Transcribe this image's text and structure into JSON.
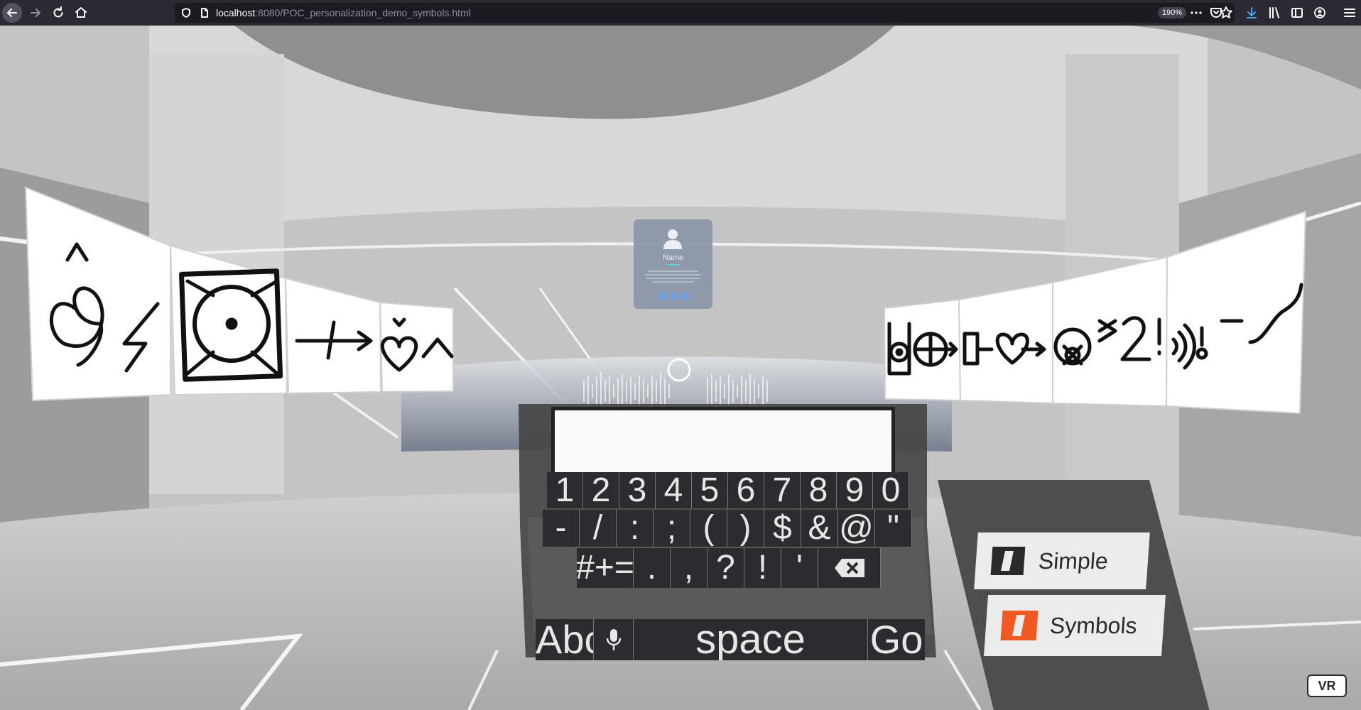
{
  "browser": {
    "url_host": "localhost",
    "url_rest": ":8080/POC_personalization_demo_symbols.html",
    "zoom": "190%"
  },
  "profile": {
    "name": "Name"
  },
  "keyboard": {
    "row1": [
      "1",
      "2",
      "3",
      "4",
      "5",
      "6",
      "7",
      "8",
      "9",
      "0"
    ],
    "row2": [
      "-",
      "/",
      ":",
      ";",
      "(",
      ")",
      "$",
      "&",
      "@",
      "\""
    ],
    "row3": [
      "#+=",
      ".",
      ",",
      "?",
      "!",
      "'"
    ],
    "row4": {
      "abc": "Abc",
      "space": "space",
      "go": "Go"
    }
  },
  "modes": {
    "simple": "Simple",
    "symbols": "Symbols",
    "simple_color": "#2a2a2a",
    "symbols_color": "#f05a22"
  },
  "vr_button": "VR"
}
